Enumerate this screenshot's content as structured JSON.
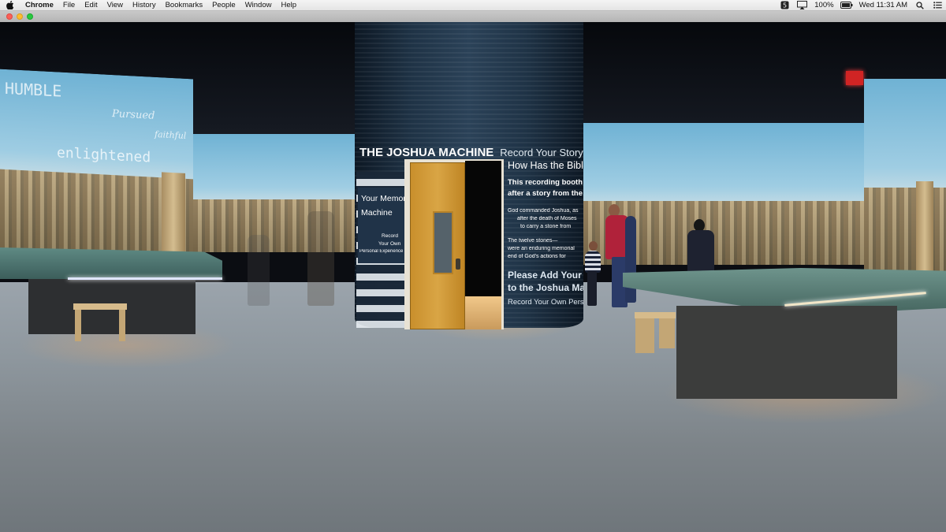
{
  "menubar": {
    "apple_icon": "apple-icon",
    "app_name": "Chrome",
    "items": [
      "File",
      "Edit",
      "View",
      "History",
      "Bookmarks",
      "People",
      "Window",
      "Help"
    ],
    "status": {
      "badge_icon_text": "5",
      "battery_percent": "100%",
      "clock": "Wed 11:31 AM"
    }
  },
  "video": {
    "exhibit": {
      "title": "THE JOSHUA MACHINE",
      "title_sub": "Record Your Story",
      "question": "How Has the Bible",
      "booth_line1": "This recording booth is",
      "booth_line2": "after a story from the",
      "body_1": "God commanded Joshua, as",
      "body_2": "after the death of Moses",
      "body_3": "to carry a stone from",
      "body_4": "The twelve stones—",
      "body_5": "were an enduring memorial",
      "body_6": "end of God's actions for",
      "cta_1": "Please Add Your",
      "cta_2": "to the Joshua Mac",
      "cta_3": "Record Your Own Person",
      "memory_1": "Your Memory",
      "memory_2": "Machine",
      "record_1": "Record",
      "record_2": "Your Own",
      "record_3": "Personal Experience"
    },
    "projections": {
      "word_1": "HUMBLE",
      "word_2": "enlightened",
      "word_3": "Pursued",
      "word_4": "faithful"
    }
  }
}
